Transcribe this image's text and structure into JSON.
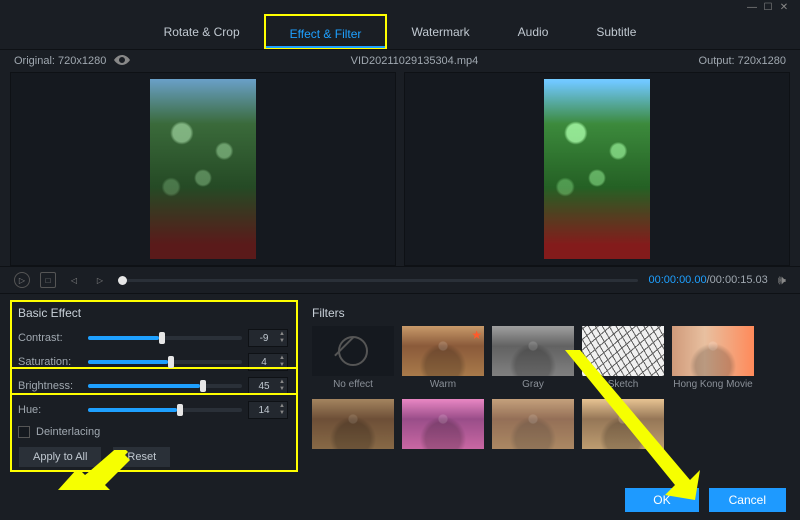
{
  "window": {
    "filename": "VID20211029135304.mp4",
    "original_label": "Original: 720x1280",
    "output_label": "Output: 720x1280"
  },
  "tabs": {
    "rotate": "Rotate & Crop",
    "effect": "Effect & Filter",
    "watermark": "Watermark",
    "audio": "Audio",
    "subtitle": "Subtitle",
    "active": "effect"
  },
  "playback": {
    "current": "00:00:00.00",
    "total": "00:00:15.03"
  },
  "basic_effect": {
    "title": "Basic Effect",
    "contrast": {
      "label": "Contrast:",
      "value": "-9",
      "pct": 46
    },
    "saturation": {
      "label": "Saturation:",
      "value": "4",
      "pct": 52
    },
    "brightness": {
      "label": "Brightness:",
      "value": "45",
      "pct": 73
    },
    "hue": {
      "label": "Hue:",
      "value": "14",
      "pct": 58
    },
    "deinterlacing": "Deinterlacing",
    "apply_all": "Apply to All",
    "reset": "Reset"
  },
  "filters": {
    "title": "Filters",
    "items": [
      {
        "label": "No effect"
      },
      {
        "label": "Warm"
      },
      {
        "label": "Gray"
      },
      {
        "label": "Sketch"
      },
      {
        "label": "Hong Kong Movie"
      },
      {
        "label": ""
      },
      {
        "label": ""
      },
      {
        "label": ""
      },
      {
        "label": ""
      }
    ]
  },
  "footer": {
    "ok": "OK",
    "cancel": "Cancel"
  }
}
